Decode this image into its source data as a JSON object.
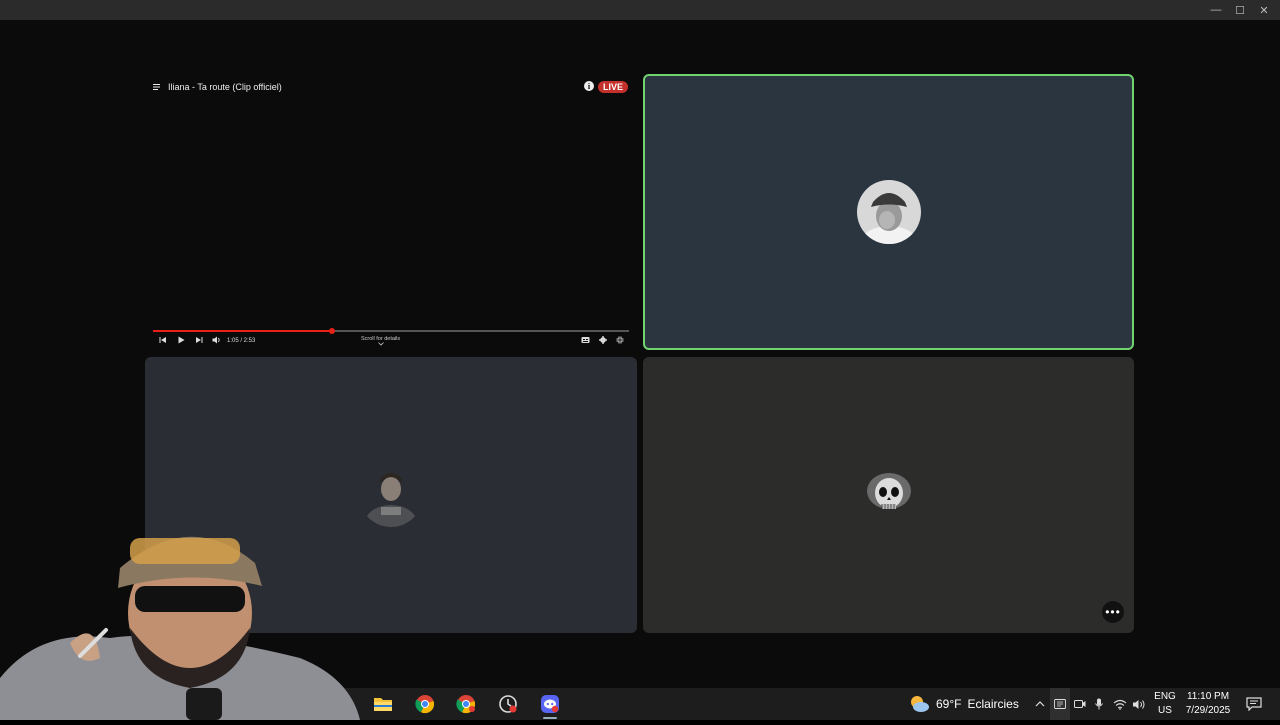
{
  "window": {
    "minimize_glyph": "—",
    "maximize_glyph": "☐",
    "close_glyph": "✕"
  },
  "video": {
    "title": "Iliana - Ta route (Clip officiel)",
    "live_label": "LIVE",
    "info_glyph": "i",
    "time": "1:05 / 2:53",
    "progress": 0.376,
    "scroll_hint": "Scroll for details",
    "colors": {
      "progress": "#e62117",
      "live": "#c4302b"
    }
  },
  "participants": [
    {
      "avatar": "cap-man-avatar",
      "speaking": true
    },
    {
      "avatar": "soldier-avatar",
      "speaking": false
    },
    {
      "avatar": "skull-avatar",
      "speaking": false
    }
  ],
  "more_options_glyph": "•••",
  "taskbar": {
    "apps": [
      "file-explorer-icon",
      "chrome-icon",
      "chrome-canary-icon",
      "clock-app-icon",
      "discord-icon"
    ],
    "active_app": "discord-icon",
    "weather": {
      "temp": "69°F",
      "condition": "Eclaircies"
    },
    "language": {
      "line1": "ENG",
      "line2": "US"
    },
    "time": "11:10 PM",
    "date": "7/29/2025"
  },
  "colors": {
    "speaking_border": "#72d36e",
    "active_tile": "#2a3540"
  }
}
